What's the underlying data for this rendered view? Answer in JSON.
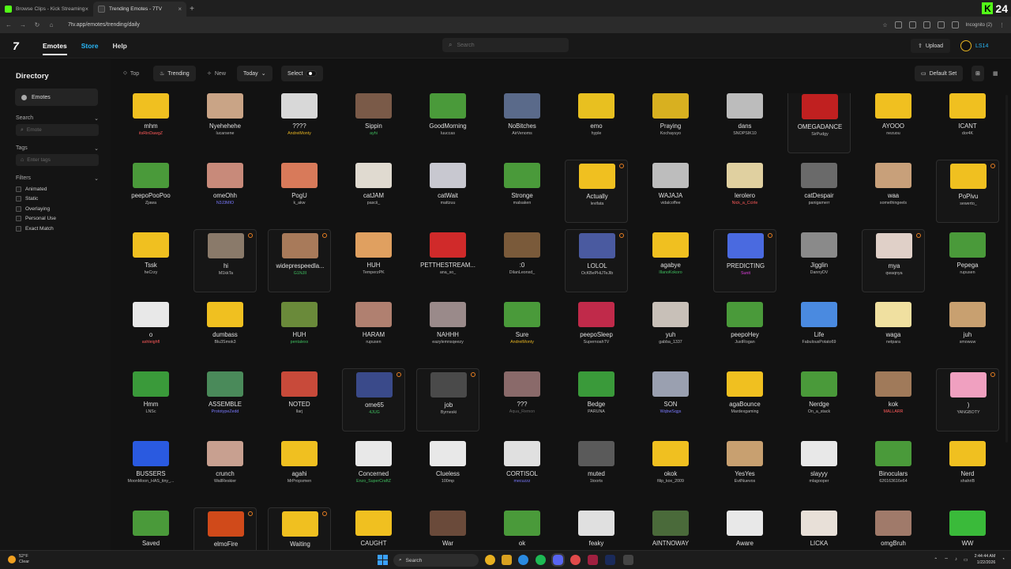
{
  "browser": {
    "tabs": [
      {
        "title": "Browse Clips - Kick Streaming"
      },
      {
        "title": "Trending Emotes - 7TV"
      }
    ],
    "new_tab": "+",
    "url": "7tv.app/emotes/trending/daily",
    "incognito": "Incognito (2)",
    "kick_count": "24"
  },
  "app": {
    "logo": "7",
    "nav": {
      "emotes": "Emotes",
      "store": "Store",
      "help": "Help"
    },
    "search_placeholder": "Search",
    "upload": "Upload",
    "username": "LS14"
  },
  "sidebar": {
    "title": "Directory",
    "emotes_pill": "Emotes",
    "search_label": "Search",
    "search_placeholder": "Emote",
    "tags_label": "Tags",
    "tags_placeholder": "Enter tags",
    "filters_label": "Filters",
    "filters": [
      "Animated",
      "Static",
      "Overlaying",
      "Personal Use",
      "Exact Match"
    ]
  },
  "filterbar": {
    "top": "Top",
    "trending": "Trending",
    "new": "New",
    "period": "Today",
    "select": "Select",
    "default_set": "Default Set"
  },
  "colors": {
    "accent": "#29b6f6",
    "kick_green": "#53fc18",
    "badge": "#e67e22"
  },
  "emotes": [
    {
      "name": "mhm",
      "author": "itsRinDawgZ",
      "author_color": "#ff5a5a",
      "color": "#f0c020"
    },
    {
      "name": "Nyehehehe",
      "author": "lucarsene",
      "author_color": "#bbbbbb",
      "color": "#c9a486"
    },
    {
      "name": "????",
      "author": "AndreiMonty",
      "author_color": "#e6b422",
      "color": "#d8d8d8"
    },
    {
      "name": "Sippin",
      "author": "ayhi",
      "author_color": "#3fbf5f",
      "color": "#7a5a48"
    },
    {
      "name": "GoodMorning",
      "author": "luuccas",
      "author_color": "#bbbbbb",
      "color": "#4a9a3a"
    },
    {
      "name": "NoBitches",
      "author": "AirVenoms",
      "author_color": "#bbbbbb",
      "color": "#5a6a8a"
    },
    {
      "name": "emo",
      "author": "hyple",
      "author_color": "#bbbbbb",
      "color": "#e8c020"
    },
    {
      "name": "Praying",
      "author": "Kochayuyo",
      "author_color": "#bbbbbb",
      "color": "#d8b020"
    },
    {
      "name": "dans",
      "author": "SNOPSIK10",
      "author_color": "#bbbbbb",
      "color": "#bcbcbc"
    },
    {
      "name": "OMEGADANCE",
      "author": "SirPudgy",
      "author_color": "#bbbbbb",
      "color": "#c02020",
      "hl": true
    },
    {
      "name": "AYOOO",
      "author": "nezuou",
      "author_color": "#bbbbbb",
      "color": "#f0c020"
    },
    {
      "name": "ICANT",
      "author": "dor4K",
      "author_color": "#bbbbbb",
      "color": "#f0c020"
    },
    {
      "name": "peepoPooPoo",
      "author": "Zjawa",
      "author_color": "#bbbbbb",
      "color": "#4a9a3a"
    },
    {
      "name": "omeOhh",
      "author": "N3J3MIO",
      "author_color": "#7a7aff",
      "color": "#c88a7a"
    },
    {
      "name": "PogU",
      "author": "k_akw",
      "author_color": "#bbbbbb",
      "color": "#d87a5a"
    },
    {
      "name": "catJAM",
      "author": "pascii_",
      "author_color": "#bbbbbb",
      "color": "#e0dad0"
    },
    {
      "name": "catWait",
      "author": "mattzuu",
      "author_color": "#bbbbbb",
      "color": "#c8c8d0"
    },
    {
      "name": "Stronge",
      "author": "malsaken",
      "author_color": "#bbbbbb",
      "color": "#4a9a3a"
    },
    {
      "name": "Actually",
      "author": "levifata",
      "author_color": "#bbbbbb",
      "color": "#f0c020",
      "hl": true,
      "badge": true
    },
    {
      "name": "WAJAJA",
      "author": "vidalcoffee",
      "author_color": "#bbbbbb",
      "color": "#bdbdbd"
    },
    {
      "name": "lerolero",
      "author": "Nick_a_Ccirle",
      "author_color": "#ff5a5a",
      "color": "#e0d0a0"
    },
    {
      "name": "catDespair",
      "author": "panigamerr",
      "author_color": "#bbbbbb",
      "color": "#6a6a6a"
    },
    {
      "name": "waa",
      "author": "somethingeels",
      "author_color": "#bbbbbb",
      "color": "#c8a07a"
    },
    {
      "name": "PoPivu",
      "author": "sewerto_",
      "author_color": "#bbbbbb",
      "color": "#f0c020",
      "hl": true,
      "badge": true
    },
    {
      "name": "Tssk",
      "author": "heCrzy",
      "author_color": "#bbbbbb",
      "color": "#f0c020"
    },
    {
      "name": "hi",
      "author": "M1kkTa",
      "author_color": "#bbbbbb",
      "color": "#8a7a6a",
      "hl": true,
      "badge": true
    },
    {
      "name": "wideprespeedla...",
      "author": "G1NJII",
      "author_color": "#3fbf5f",
      "color": "#a87a5a",
      "hl": true,
      "badge": true
    },
    {
      "name": "HUH",
      "author": "TemperzPK",
      "author_color": "#bbbbbb",
      "color": "#e0a060"
    },
    {
      "name": "PETTHESTREAM...",
      "author": "ana_so_",
      "author_color": "#bbbbbb",
      "color": "#d02a2a"
    },
    {
      "name": ":0",
      "author": "DilanLeonxd_",
      "author_color": "#bbbbbb",
      "color": "#7a5a3a"
    },
    {
      "name": "LOLOL",
      "author": "OcKBePHiJTeJlb",
      "author_color": "#bbbbbb",
      "color": "#4a5aa0",
      "hl": true,
      "badge": true
    },
    {
      "name": "agabye",
      "author": "IllanoKokoro",
      "author_color": "#3fbf5f",
      "color": "#f0c020"
    },
    {
      "name": "PREDICTING",
      "author": "Sunit",
      "author_color": "#e040e0",
      "color": "#4a6ae0",
      "hl": true,
      "badge": true
    },
    {
      "name": "Jigglin",
      "author": "DannyDV",
      "author_color": "#bbbbbb",
      "color": "#8a8a8a"
    },
    {
      "name": "mya",
      "author": "qwaqnya",
      "author_color": "#bbbbbb",
      "color": "#e0d0c8",
      "hl": true,
      "badge": true
    },
    {
      "name": "Pepega",
      "author": "rupusen",
      "author_color": "#bbbbbb",
      "color": "#4a9a3a"
    },
    {
      "name": "o",
      "author": "ashleighfl",
      "author_color": "#ff5a5a",
      "color": "#e8e8e8"
    },
    {
      "name": "dumbass",
      "author": "Blu3Smok3",
      "author_color": "#bbbbbb",
      "color": "#f0c020"
    },
    {
      "name": "HUH",
      "author": "pentalexx",
      "author_color": "#3fbf5f",
      "color": "#6a8a3a"
    },
    {
      "name": "HARAM",
      "author": "rupusen",
      "author_color": "#bbbbbb",
      "color": "#b08070"
    },
    {
      "name": "NAHHH",
      "author": "eazylemnsqeezy",
      "author_color": "#bbbbbb",
      "color": "#9a8a8a"
    },
    {
      "name": "Sure",
      "author": "AndreiMonty",
      "author_color": "#e6b422",
      "color": "#4a9a3a"
    },
    {
      "name": "peepoSleep",
      "author": "SupernoahTV",
      "author_color": "#bbbbbb",
      "color": "#c02a4a"
    },
    {
      "name": "yuh",
      "author": "gabba_1337",
      "author_color": "#bbbbbb",
      "color": "#c8c0b8"
    },
    {
      "name": "peepoHey",
      "author": "JustRogan",
      "author_color": "#bbbbbb",
      "color": "#4a9a3a"
    },
    {
      "name": "Life",
      "author": "FabulousPotato69",
      "author_color": "#bbbbbb",
      "color": "#4a8ae0"
    },
    {
      "name": "waga",
      "author": "netpara",
      "author_color": "#bbbbbb",
      "color": "#f0e0a0"
    },
    {
      "name": "juh",
      "author": "smowuw",
      "author_color": "#bbbbbb",
      "color": "#c8a070"
    },
    {
      "name": "Hmm",
      "author": "LNSc",
      "author_color": "#bbbbbb",
      "color": "#3a9a3a"
    },
    {
      "name": "ASSEMBLE",
      "author": "PrototypeZedd",
      "author_color": "#7a7aff",
      "color": "#4a8a5a"
    },
    {
      "name": "NOTED",
      "author": "llarj",
      "author_color": "#bbbbbb",
      "color": "#c84a3a"
    },
    {
      "name": "ome65",
      "author": "4JUG",
      "author_color": "#3fbf5f",
      "color": "#3a4a8a",
      "hl": true,
      "badge": true
    },
    {
      "name": "job",
      "author": "Byrneski",
      "author_color": "#bbbbbb",
      "color": "#4a4a4a",
      "hl": true,
      "badge": true
    },
    {
      "name": "???",
      "author": "Aqua_Remon",
      "author_color": "#666666",
      "color": "#8a6a6a"
    },
    {
      "name": "Bedge",
      "author": "PARUNA",
      "author_color": "#bbbbbb",
      "color": "#3a9a3a"
    },
    {
      "name": "SON",
      "author": "WqbwSqgs",
      "author_color": "#7a7aff",
      "color": "#9aa0b0"
    },
    {
      "name": "agaBounce",
      "author": "Mardexgaming",
      "author_color": "#bbbbbb",
      "color": "#f0c020"
    },
    {
      "name": "Nerdge",
      "author": "On_a_stack",
      "author_color": "#bbbbbb",
      "color": "#4a9a3a"
    },
    {
      "name": "kok",
      "author": "MALLARR",
      "author_color": "#ff5a5a",
      "color": "#a07a5a"
    },
    {
      "name": ")",
      "author": "YANGBOTY",
      "author_color": "#bbbbbb",
      "color": "#f0a0c0",
      "hl": true,
      "badge": true
    },
    {
      "name": "BUSSERS",
      "author": "MoonMoon_HAS_tiny_...",
      "author_color": "#bbbbbb",
      "color": "#2a5ae0"
    },
    {
      "name": "crunch",
      "author": "WallReskier",
      "author_color": "#bbbbbb",
      "color": "#c8a090"
    },
    {
      "name": "agahi",
      "author": "MrPropsmen",
      "author_color": "#bbbbbb",
      "color": "#f0c020"
    },
    {
      "name": "Concerned",
      "author": "Enzo_SuperCraftZ",
      "author_color": "#3fbf5f",
      "color": "#e8e8e8"
    },
    {
      "name": "Clueless",
      "author": "100mp",
      "author_color": "#bbbbbb",
      "color": "#e8e8e8"
    },
    {
      "name": "CORTISOL",
      "author": "mecuzzz",
      "author_color": "#7a7aff",
      "color": "#e0e0e0"
    },
    {
      "name": "muted",
      "author": "1toorts",
      "author_color": "#bbbbbb",
      "color": "#5a5a5a"
    },
    {
      "name": "okok",
      "author": "filip_kox_2009",
      "author_color": "#bbbbbb",
      "color": "#f0c020"
    },
    {
      "name": "YesYes",
      "author": "EvilNuevos",
      "author_color": "#bbbbbb",
      "color": "#c8a070"
    },
    {
      "name": "slayyy",
      "author": "mlagooper",
      "author_color": "#bbbbbb",
      "color": "#e8e8e8"
    },
    {
      "name": "Binoculars",
      "author": "626163616e64",
      "author_color": "#bbbbbb",
      "color": "#4a9a3a"
    },
    {
      "name": "Nerd",
      "author": "shahriB",
      "author_color": "#bbbbbb",
      "color": "#f0c020"
    },
    {
      "name": "Saved",
      "author": "",
      "author_color": "#bbbbbb",
      "color": "#4a9a3a"
    },
    {
      "name": "elmoFire",
      "author": "",
      "author_color": "#bbbbbb",
      "color": "#d04a1a",
      "hl": true,
      "badge": true
    },
    {
      "name": "Waiting",
      "author": "",
      "author_color": "#bbbbbb",
      "color": "#f0c020",
      "hl": true,
      "badge": true
    },
    {
      "name": "CAUGHT",
      "author": "",
      "author_color": "#bbbbbb",
      "color": "#f0c020"
    },
    {
      "name": "War",
      "author": "",
      "author_color": "#bbbbbb",
      "color": "#6a4a3a"
    },
    {
      "name": "ok",
      "author": "",
      "author_color": "#bbbbbb",
      "color": "#4a9a3a"
    },
    {
      "name": "feaky",
      "author": "",
      "author_color": "#bbbbbb",
      "color": "#e0e0e0"
    },
    {
      "name": "AINTNOWAY",
      "author": "",
      "author_color": "#bbbbbb",
      "color": "#4a6a3a"
    },
    {
      "name": "Aware",
      "author": "",
      "author_color": "#bbbbbb",
      "color": "#e8e8e8"
    },
    {
      "name": "LICKA",
      "author": "",
      "author_color": "#bbbbbb",
      "color": "#e8e0d8"
    },
    {
      "name": "omgBruh",
      "author": "",
      "author_color": "#bbbbbb",
      "color": "#a07a6a"
    },
    {
      "name": "WW",
      "author": "",
      "author_color": "#bbbbbb",
      "color": "#3aba3a"
    }
  ],
  "taskbar": {
    "temp": "52°F",
    "weather": "Clear",
    "search": "Search",
    "time": "2:44:44 AM",
    "date": "1/22/2026"
  }
}
